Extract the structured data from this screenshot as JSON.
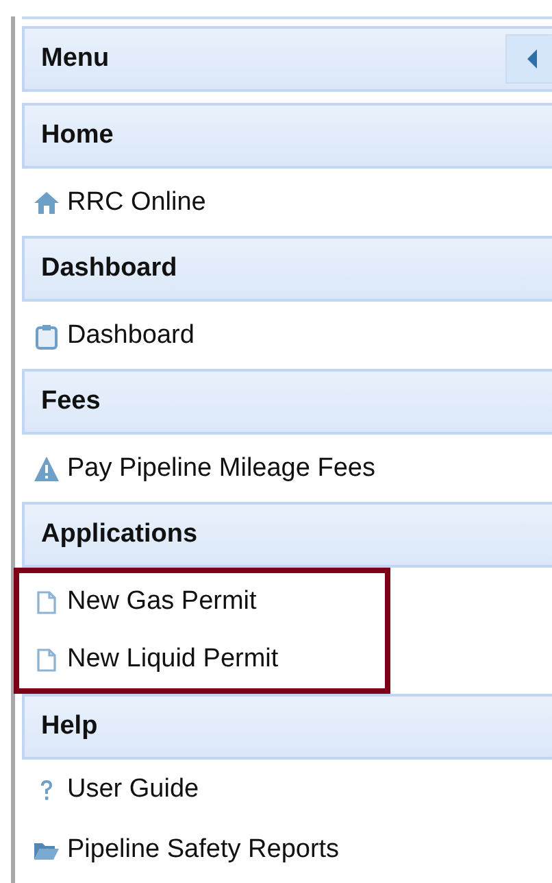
{
  "menu": {
    "title": "Menu",
    "collapse_button": {
      "expanded": true
    }
  },
  "sections": [
    {
      "title": "Home",
      "highlighted": false,
      "items": [
        {
          "label": "RRC Online",
          "kind": "home"
        }
      ]
    },
    {
      "title": "Dashboard",
      "highlighted": false,
      "items": [
        {
          "label": "Dashboard",
          "kind": "clipboard"
        }
      ]
    },
    {
      "title": "Fees",
      "highlighted": false,
      "items": [
        {
          "label": "Pay Pipeline Mileage Fees",
          "kind": "warning"
        }
      ]
    },
    {
      "title": "Applications",
      "highlighted": true,
      "items": [
        {
          "label": "New Gas Permit",
          "kind": "document"
        },
        {
          "label": "New Liquid Permit",
          "kind": "document"
        }
      ]
    },
    {
      "title": "Help",
      "highlighted": false,
      "items": [
        {
          "label": "User Guide",
          "kind": "help"
        },
        {
          "label": "Pipeline Safety Reports",
          "kind": "folder"
        }
      ]
    }
  ]
}
